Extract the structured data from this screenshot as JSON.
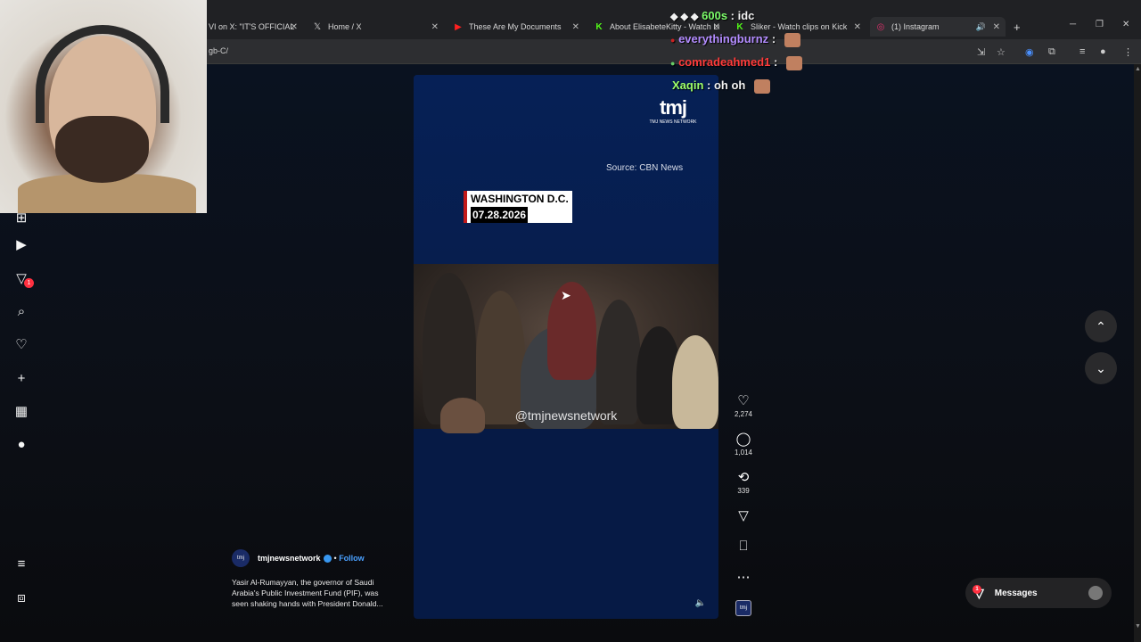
{
  "browser": {
    "tabs": [
      {
        "title": "VI on X: \"IT'S OFFICIAL",
        "icon": "x-logo-icon"
      },
      {
        "title": "Home / X",
        "icon": "x-logo-icon"
      },
      {
        "title": "These Are My Documents",
        "icon": "youtube-icon"
      },
      {
        "title": "About ElisabeteKitty - Watch Li",
        "icon": "kick-icon"
      },
      {
        "title": "Sliker - Watch clips on Kick",
        "icon": "kick-icon"
      },
      {
        "title": "(1) Instagram",
        "icon": "instagram-icon",
        "active": true
      }
    ],
    "url": "gb-C/",
    "new_tab": "+"
  },
  "chat_overlay": [
    {
      "user": "600s",
      "text": ": idc",
      "color": "#7CFC6A"
    },
    {
      "user": "everythingburnz",
      "text": ":",
      "color": "#b38cff"
    },
    {
      "user": "comradeahmed1",
      "text": ":",
      "color": "#ff3b3b"
    },
    {
      "user": "Xaqin",
      "text": ": oh oh",
      "color": "#9dff6a"
    }
  ],
  "reel": {
    "logo_mark": "tmj",
    "logo_sub": "TMJ NEWS NETWORK",
    "source": "Source: CBN News",
    "location": "WASHINGTON D.C.",
    "date": "07.28.2026",
    "watermark": "@tmjnewsnetwork"
  },
  "actions": {
    "likes": "2,274",
    "comments": "1,014",
    "reposts": "339"
  },
  "author": {
    "avatar_text": "tmj",
    "name": "tmjnewsnetwork",
    "separator": "•",
    "follow": "Follow",
    "caption": "Yasir Al-Rumayyan, the governor of Saudi Arabia's Public Investment Fund (PIF), was seen shaking hands with President Donald..."
  },
  "sidebar": {
    "notification_count": "1"
  },
  "messages": {
    "label": "Messages",
    "badge": "1"
  },
  "colors": {
    "reel_bg": "#061a45",
    "accent_red": "#ff3040",
    "link_blue": "#4aa0ff"
  }
}
